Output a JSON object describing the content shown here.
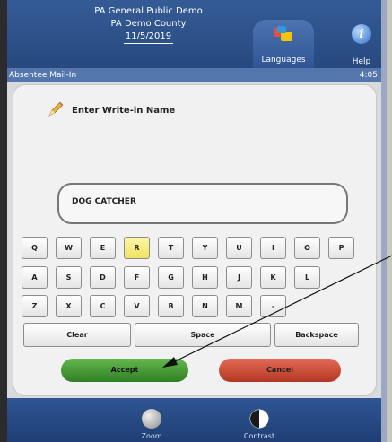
{
  "election": {
    "name": "PA General Public Demo",
    "county": "PA Demo County",
    "date": "11/5/2019"
  },
  "nav": {
    "languages_label": "Languages",
    "help_label": "Help",
    "help_icon_glyph": "i"
  },
  "status": {
    "ballot_type": "Absentee Mail-In",
    "time": "4:05"
  },
  "writein": {
    "title": "Enter Write-in Name",
    "value": "DOG CATCHER"
  },
  "keyboard": {
    "rows": [
      [
        "Q",
        "W",
        "E",
        "R",
        "T",
        "Y",
        "U",
        "I",
        "O",
        "P"
      ],
      [
        "A",
        "S",
        "D",
        "F",
        "G",
        "H",
        "J",
        "K",
        "L"
      ],
      [
        "Z",
        "X",
        "C",
        "V",
        "B",
        "N",
        "M",
        "-"
      ]
    ],
    "highlighted_key": "R",
    "clear_label": "Clear",
    "space_label": "Space",
    "backspace_label": "Backspace"
  },
  "actions": {
    "accept_label": "Accept",
    "cancel_label": "Cancel"
  },
  "footer": {
    "zoom_label": "Zoom",
    "contrast_label": "Contrast"
  },
  "colors": {
    "header_blue": "#2f5594",
    "accept_green": "#3f9a32",
    "cancel_red": "#c94a35",
    "highlight_yellow": "#f6e96f"
  }
}
